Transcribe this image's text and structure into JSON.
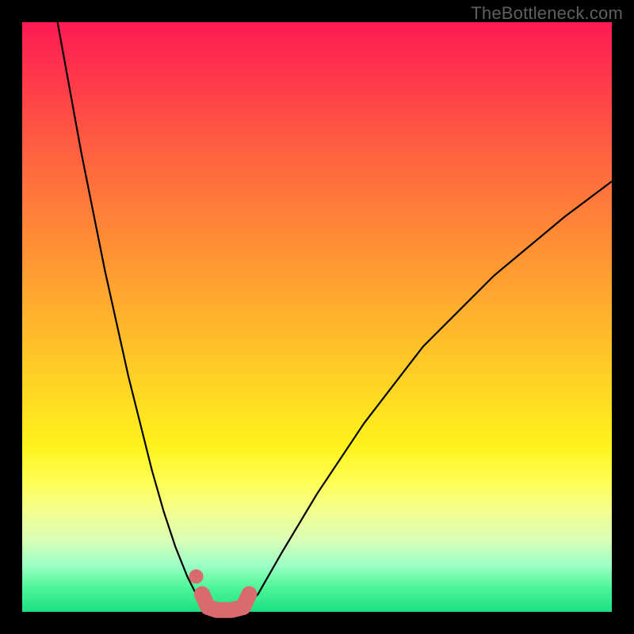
{
  "watermark": "TheBottleneck.com",
  "chart_data": {
    "type": "line",
    "title": "",
    "xlabel": "",
    "ylabel": "",
    "xlim": [
      0,
      100
    ],
    "ylim": [
      0,
      100
    ],
    "grid": false,
    "legend": false,
    "background": "red-to-green vertical gradient (heatmap-style)",
    "series": [
      {
        "name": "left-curve",
        "x": [
          6,
          10,
          14,
          18,
          20,
          22,
          24,
          26,
          28,
          29.5,
          30.5,
          31
        ],
        "values": [
          100,
          78,
          58,
          40,
          32,
          24,
          17,
          11,
          6,
          3,
          1.5,
          1
        ]
      },
      {
        "name": "right-curve",
        "x": [
          38,
          40,
          44,
          50,
          58,
          68,
          80,
          92,
          100
        ],
        "values": [
          1,
          3,
          10,
          20,
          32,
          45,
          57,
          67,
          73
        ]
      },
      {
        "name": "valley-marker",
        "x": [
          30.5,
          31.5,
          33,
          35.5,
          37.5,
          38.5
        ],
        "values": [
          3,
          0.8,
          0.3,
          0.3,
          0.8,
          3
        ]
      }
    ],
    "annotations": [
      {
        "type": "dot",
        "x": 29.5,
        "y": 6,
        "color": "#d96b6f"
      }
    ]
  }
}
